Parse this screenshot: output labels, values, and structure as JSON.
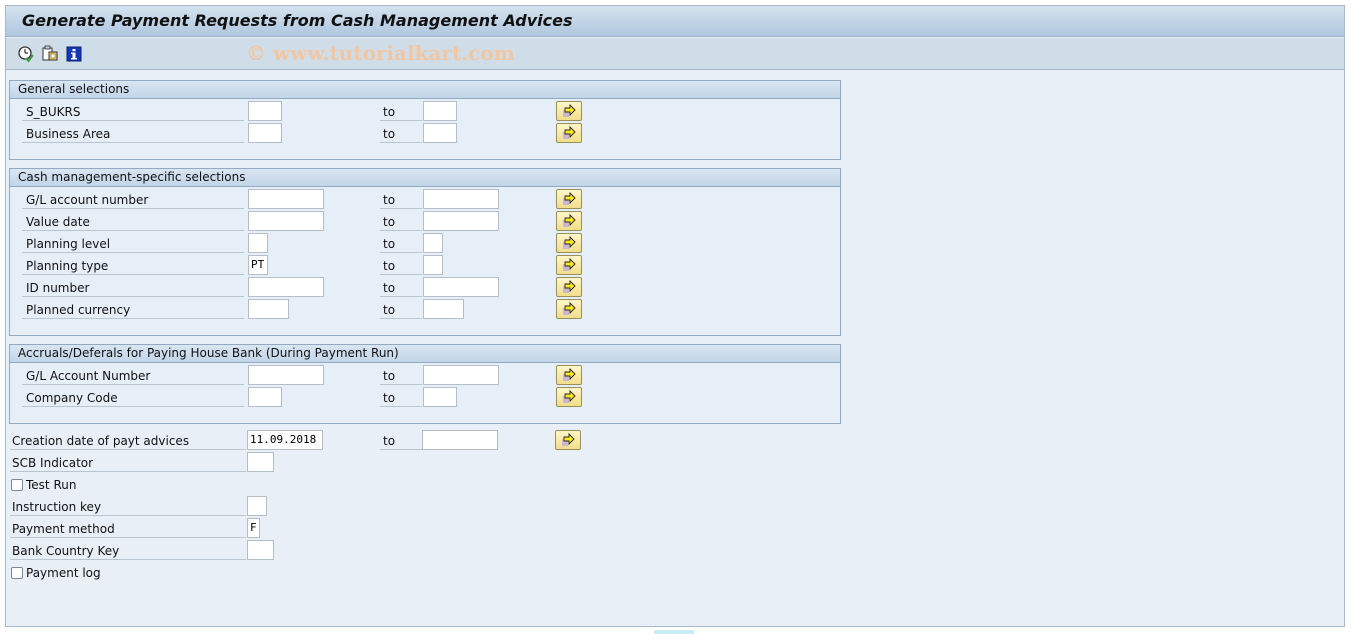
{
  "window": {
    "title": "Generate Payment Requests from Cash Management Advices",
    "watermark": "© www.tutorialkart.com"
  },
  "toolbar": {
    "icons": [
      "execute-icon",
      "get-variant-icon",
      "info-icon"
    ]
  },
  "to_label": "to",
  "groups": [
    {
      "title": "General selections",
      "rows": [
        {
          "label": "S_BUKRS",
          "from": "",
          "to": ""
        },
        {
          "label": "Business Area",
          "from": "",
          "to": ""
        }
      ]
    },
    {
      "title": "Cash management-specific selections",
      "rows": [
        {
          "label": "G/L account number",
          "from": "",
          "to": ""
        },
        {
          "label": "Value date",
          "from": "",
          "to": ""
        },
        {
          "label": "Planning level",
          "from": "",
          "to": ""
        },
        {
          "label": "Planning type",
          "from": "PT",
          "to": ""
        },
        {
          "label": "ID number",
          "from": "",
          "to": ""
        },
        {
          "label": "Planned currency",
          "from": "",
          "to": ""
        }
      ]
    },
    {
      "title": "Accruals/Deferals for Paying House Bank (During Payment Run)",
      "rows": [
        {
          "label": "G/L Account Number",
          "from": "",
          "to": ""
        },
        {
          "label": "Company Code",
          "from": "",
          "to": ""
        }
      ]
    }
  ],
  "fields": {
    "creation_date": {
      "label": "Creation date of payt advices",
      "from": "11.09.2018",
      "to": ""
    },
    "scb_indicator": {
      "label": "SCB Indicator",
      "value": ""
    },
    "test_run": {
      "label": "Test Run",
      "checked": false
    },
    "instruction_key": {
      "label": "Instruction key",
      "value": ""
    },
    "payment_method": {
      "label": "Payment method",
      "value": "F"
    },
    "bank_country_key": {
      "label": "Bank Country Key",
      "value": ""
    },
    "payment_log": {
      "label": "Payment log",
      "checked": false
    }
  }
}
